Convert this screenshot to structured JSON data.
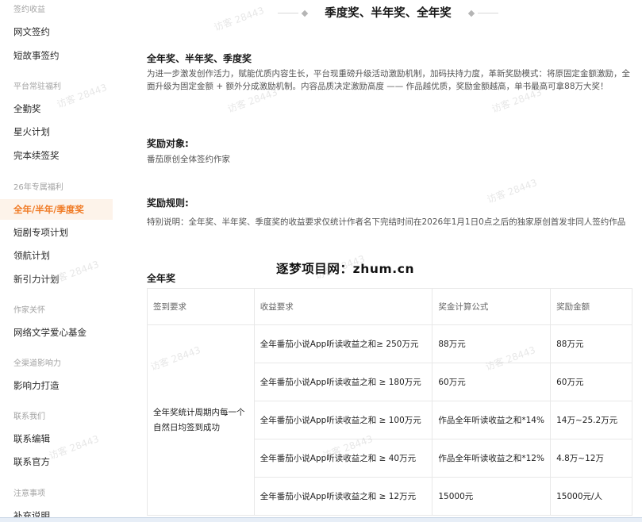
{
  "sidebar": {
    "groups": [
      {
        "label": "签约收益",
        "items": [
          "网文签约",
          "短故事签约"
        ]
      },
      {
        "label": "平台常驻福利",
        "items": [
          "全勤奖",
          "星火计划",
          "完本续签奖"
        ]
      },
      {
        "label": "26年专属福利",
        "items": [
          "全年/半年/季度奖",
          "短剧专项计划",
          "领航计划",
          "新引力计划"
        ]
      },
      {
        "label": "作家关怀",
        "items": [
          "网络文学爱心基金"
        ]
      },
      {
        "label": "全渠道影响力",
        "items": [
          "影响力打造"
        ]
      },
      {
        "label": "联系我们",
        "items": [
          "联系编辑",
          "联系官方"
        ]
      },
      {
        "label": "注意事项",
        "items": [
          "补充说明"
        ]
      }
    ],
    "active_item": "全年/半年/季度奖"
  },
  "main": {
    "title": "季度奖、半年奖、全年奖",
    "section_title": "全年奖、半年奖、季度奖",
    "intro": "为进一步激发创作活力，赋能优质内容生长，平台现重磅升级活动激励机制，加码扶持力度，革新奖励模式：将原固定金额激励，全面升级为固定金额 + 额外分成激励机制。内容品质决定激励高度 —— 作品越优质，奖励金额越高，单书最高可拿88万大奖！",
    "target_title": "奖励对象:",
    "target_text": "番茄原创全体签约作家",
    "rules_title": "奖励规则:",
    "rules_text": "特别说明：全年奖、半年奖、季度奖的收益要求仅统计作者名下完结时间在2026年1月1日0点之后的独家原创首发非同人签约作品",
    "annual_title": "全年奖",
    "table": {
      "headers": [
        "签到要求",
        "收益要求",
        "奖金计算公式",
        "奖励金额"
      ],
      "sign_requirement": "全年奖统计周期内每一个自然日均签到成功",
      "rows": [
        {
          "income": "全年番茄小说App听读收益之和≥ 250万元",
          "formula": "88万元",
          "amount": "88万元"
        },
        {
          "income": "全年番茄小说App听读收益之和 ≥ 180万元",
          "formula": "60万元",
          "amount": "60万元"
        },
        {
          "income": "全年番茄小说App听读收益之和 ≥ 100万元",
          "formula": "作品全年听读收益之和*14%",
          "amount": "14万~25.2万元"
        },
        {
          "income": "全年番茄小说App听读收益之和 ≥ 40万元",
          "formula": "作品全年听读收益之和*12%",
          "amount": "4.8万~12万"
        },
        {
          "income": "全年番茄小说App听读收益之和 ≥ 12万元",
          "formula": "15000元",
          "amount": "15000元/人"
        }
      ]
    }
  },
  "overlay_text": "逐梦项目网：zhum.cn",
  "watermark_text": "访客 28443",
  "colors": {
    "accent": "#f07a24",
    "active_bg": "#fdf3ea",
    "border": "#e8e8e8"
  }
}
